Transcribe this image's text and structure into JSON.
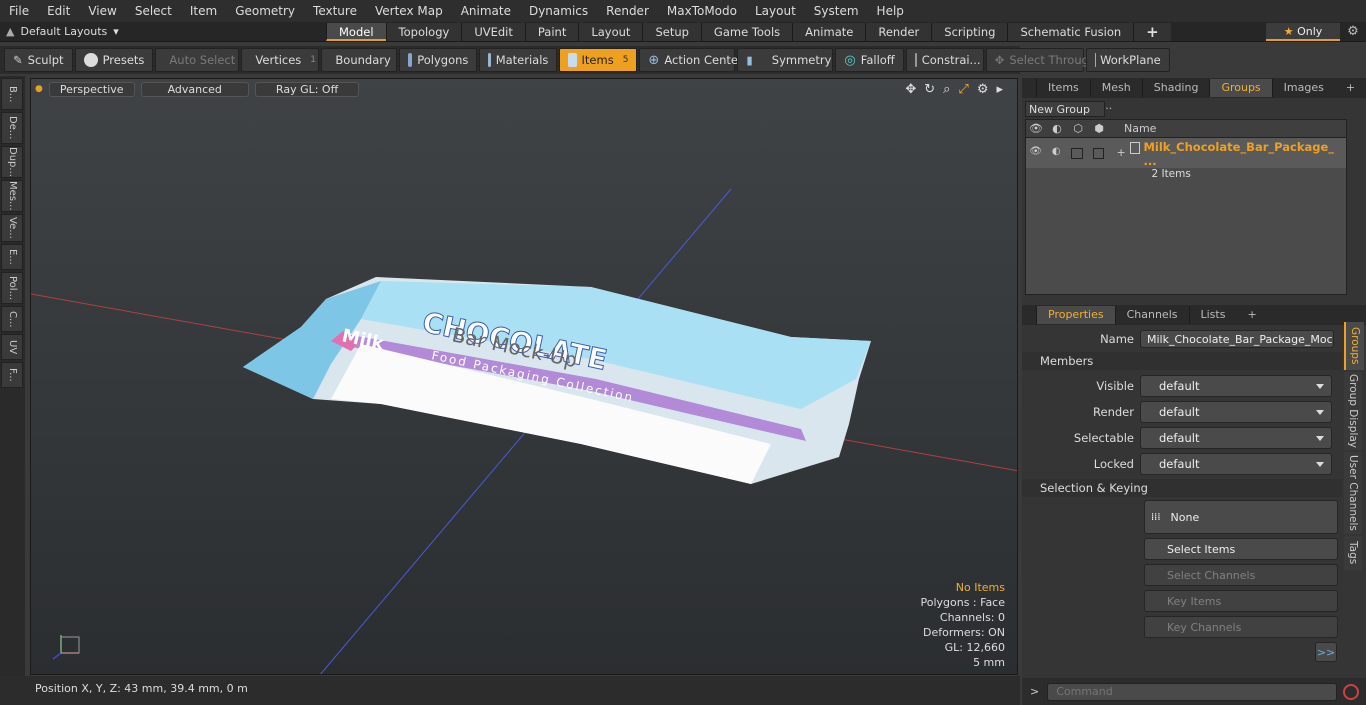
{
  "menu": [
    "File",
    "Edit",
    "View",
    "Select",
    "Item",
    "Geometry",
    "Texture",
    "Vertex Map",
    "Animate",
    "Dynamics",
    "Render",
    "MaxToModo",
    "Layout",
    "System",
    "Help"
  ],
  "layouts_label": "Default Layouts",
  "mode_tabs": [
    {
      "label": "Model",
      "active": true
    },
    {
      "label": "Topology"
    },
    {
      "label": "UVEdit"
    },
    {
      "label": "Paint"
    },
    {
      "label": "Layout"
    },
    {
      "label": "Setup"
    },
    {
      "label": "Game Tools"
    },
    {
      "label": "Animate"
    },
    {
      "label": "Render"
    },
    {
      "label": "Scripting"
    },
    {
      "label": "Schematic Fusion"
    }
  ],
  "only_label": "Only",
  "toolbar": {
    "sculpt": "Sculpt",
    "presets": "Presets",
    "auto_select": "Auto Select",
    "vertices": "Vertices",
    "vertices_count": "1",
    "boundary": "Boundary",
    "polygons": "Polygons",
    "materials": "Materials",
    "items": "Items",
    "items_count": "5",
    "action_center": "Action Center",
    "symmetry": "Symmetry",
    "falloff": "Falloff",
    "constraints": "Constrai...",
    "select_through": "Select Through",
    "workplane": "WorkPlane"
  },
  "left_tabs": [
    "B...",
    "De...",
    "Dup...",
    "Mes...",
    "Ve...",
    "E...",
    "Pol...",
    "C...",
    "UV",
    "F..."
  ],
  "viewport": {
    "perspective": "Perspective",
    "advanced": "Advanced",
    "raygl": "Ray GL: Off",
    "stats": {
      "items": "No Items",
      "polygons": "Polygons : Face",
      "channels": "Channels: 0",
      "deformers": "Deformers: ON",
      "gl": "GL: 12,660",
      "scale": "5 mm"
    },
    "package": {
      "title": "CHOCOLATE",
      "subtitle": "Bar Mock-Up",
      "milk": "Milk",
      "strip": "Food Packaging Collection"
    }
  },
  "status": "Position X, Y, Z:  43 mm, 39.4 mm, 0 m",
  "top_right_tabs": [
    {
      "label": "Items"
    },
    {
      "label": "Mesh ..."
    },
    {
      "label": "Shading"
    },
    {
      "label": "Groups",
      "active": true
    },
    {
      "label": "Images"
    }
  ],
  "groups": {
    "new_group": "New Group",
    "col_name": "Name",
    "group_name": "Milk_Chocolate_Bar_Package_ ...",
    "group_count": "2 Items"
  },
  "props_tabs": [
    {
      "label": "Properties",
      "active": true
    },
    {
      "label": "Channels"
    },
    {
      "label": "Lists"
    }
  ],
  "properties": {
    "name_label": "Name",
    "name_value": "Milk_Chocolate_Bar_Package_Mockup",
    "members": "Members",
    "visible_label": "Visible",
    "visible": "default",
    "render_label": "Render",
    "render": "default",
    "selectable_label": "Selectable",
    "selectable": "default",
    "locked_label": "Locked",
    "locked": "default",
    "sel_keying": "Selection & Keying",
    "none": "None",
    "select_items": "Select Items",
    "select_channels": "Select Channels",
    "key_items": "Key Items",
    "key_channels": "Key Channels",
    "more": ">>"
  },
  "side_tabs": [
    "Groups",
    "Group Display",
    "User Channels",
    "Tags"
  ],
  "command_placeholder": "Command",
  "colors": {
    "accent": "#f0a020",
    "bg": "#3a3a3a",
    "panel": "#353535"
  }
}
